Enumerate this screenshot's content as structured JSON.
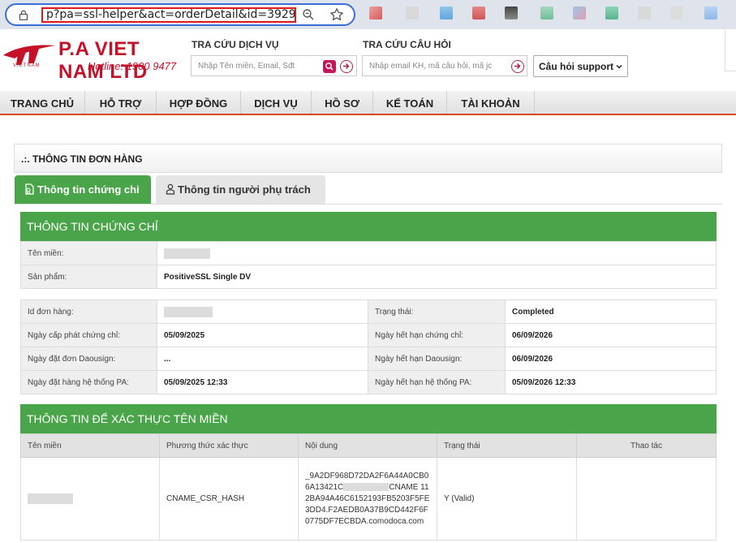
{
  "browser": {
    "url": "p?pa=ssl-helper&act=orderDetail&id=3929"
  },
  "header": {
    "logo_text": "P.A VIET NAM LTD",
    "hotline": "Hotline: 1900 9477",
    "logo_sub": "VIETNAM",
    "lookup_service": {
      "title": "TRA CỨU DỊCH VỤ",
      "placeholder": "Nhập Tên miền, Email, Sđt"
    },
    "lookup_question": {
      "title": "TRA CỨU CÂU HỎI",
      "placeholder": "Nhập email KH, mã câu hỏi, mã jc"
    },
    "support_select": "Câu hỏi support"
  },
  "nav": [
    "TRANG CHỦ",
    "HỖ TRỢ",
    "HỢP ĐỒNG",
    "DỊCH VỤ",
    "HỒ SƠ",
    "KẾ TOÁN",
    "TÀI KHOẢN"
  ],
  "section_title": ".:. THÔNG TIN ĐƠN HÀNG",
  "tabs": {
    "cert": "Thông tin chứng chỉ",
    "owner": "Thông tin người phụ trách"
  },
  "cert_info": {
    "title": "THÔNG TIN CHỨNG CHỈ",
    "domain_label": "Tên miền:",
    "product_label": "Sản phẩm:",
    "product_value": "PositiveSSL Single DV"
  },
  "order": {
    "id_label": "Id đơn hàng:",
    "status_label": "Trạng thái:",
    "status_value": "Completed",
    "issued_label": "Ngày cấp phát chứng chỉ:",
    "issued_value": "05/09/2025",
    "expire_label": "Ngày hết hạn chứng chỉ:",
    "expire_value": "06/09/2026",
    "dao_order_label": "Ngày đặt đơn Daousign:",
    "dao_order_value": "...",
    "dao_expire_label": "Ngày hết hạn Daousign:",
    "dao_expire_value": "06/09/2026",
    "pa_order_label": "Ngày đặt hàng hệ thống PA:",
    "pa_order_value": "05/09/2025 12:33",
    "pa_expire_label": "Ngày hết hạn hệ thống PA:",
    "pa_expire_value": "05/09/2026 12:33"
  },
  "verify": {
    "title": "THÔNG TIN ĐỂ XÁC THỰC TÊN MIỀN",
    "columns": [
      "Tên miền",
      "Phương thức xác thực",
      "Nội dung",
      "Trạng thái",
      "Thao tác"
    ],
    "row": {
      "method": "CNAME_CSR_HASH",
      "content_a": "_9A2DF968D72DA2F6A44A0CB06A13421C",
      "content_b": "CNAME 112BA94A46C6152193FB5203F5FE3DD4.F2AEDB0A37B9CD442F6F0775DF7ECBDA.comodoca.com",
      "status": "Y (Valid)"
    }
  },
  "colors": {
    "green": "#4aa449",
    "brand_red": "#c5102a",
    "nav_accent": "#d84a1b",
    "url_highlight": "#e01818"
  }
}
